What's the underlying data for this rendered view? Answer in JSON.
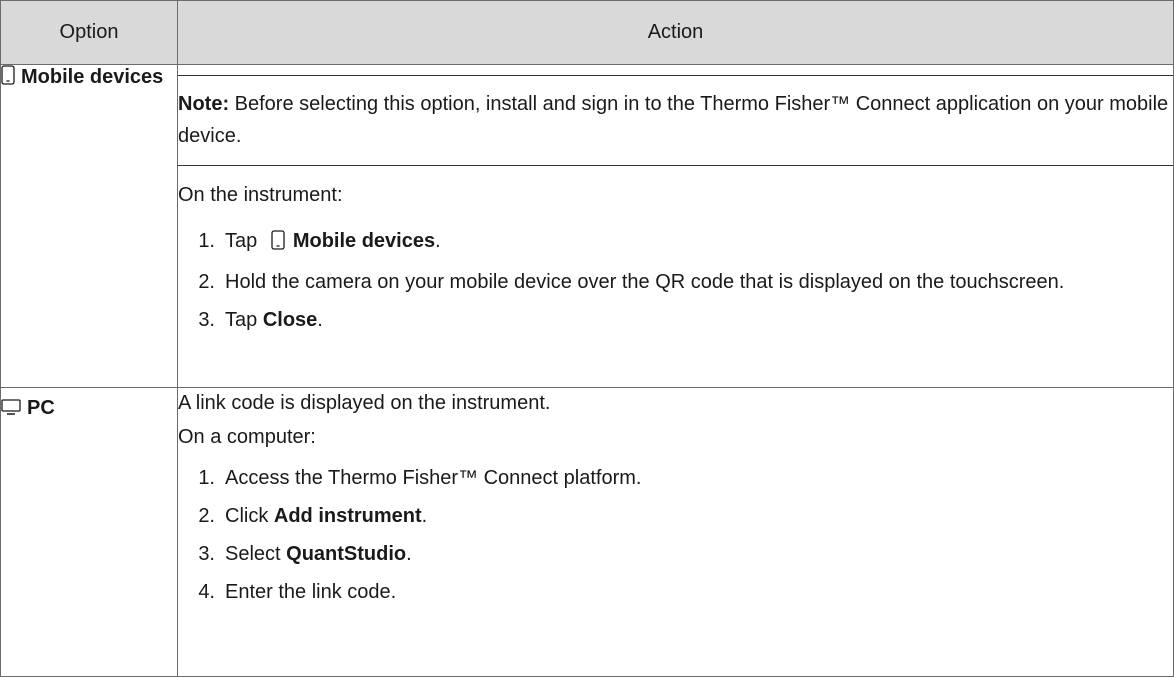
{
  "table": {
    "header": {
      "option": "Option",
      "action": "Action"
    },
    "rows": [
      {
        "option_label": "Mobile devices",
        "option_icon": "mobile-device-icon",
        "note_label": "Note:",
        "note_text": " Before selecting this option, install and sign in to the Thermo Fisher™ Connect application on your mobile device.",
        "intro": "On the instrument:",
        "steps": [
          {
            "num": "1.",
            "pre": "Tap ",
            "icon": "mobile-device-icon",
            "bold": "Mobile devices",
            "post": "."
          },
          {
            "num": "2.",
            "text": "Hold the camera on your mobile device over the QR code that is displayed on the touchscreen."
          },
          {
            "num": "3.",
            "pre": "Tap ",
            "bold": "Close",
            "post": "."
          }
        ]
      },
      {
        "option_label": "PC",
        "option_icon": "pc-monitor-icon",
        "line1": "A link code is displayed on the instrument.",
        "line2": "On a computer:",
        "steps": [
          {
            "num": "1.",
            "text": "Access the Thermo Fisher™ Connect platform."
          },
          {
            "num": "2.",
            "pre": "Click ",
            "bold": "Add instrument",
            "post": "."
          },
          {
            "num": "3.",
            "pre": "Select ",
            "bold": "QuantStudio",
            "post": "."
          },
          {
            "num": "4.",
            "text": "Enter the link code."
          }
        ]
      }
    ]
  }
}
